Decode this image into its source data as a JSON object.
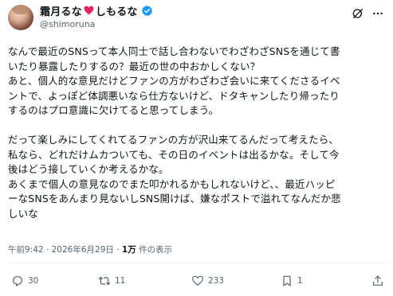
{
  "post": {
    "display_name": "霜月るな",
    "display_name_suffix": "しもるな",
    "handle": "@shimoruna",
    "body": "なんで最近のSNSって本人同士で話し合わないでわざわざSNSを通じて書\nいたり暴露したりするの？最近の世の中おかしくない？\nあと、個人的な意見だけどファンの方がわざわざ会いに来てくださるイベ\nントで、よっぽど体調悪いなら仕方ないけど、ドタキャンしたり帰ったり\nするのはプロ意識に欠けてると思ってしまう。\n\nだって楽しみにしてくれてるファンの方が沢山来てるんだって考えたら、\n私なら、どれだけムカついても、その日のイベントは出るかな。そして今\n後はどう接していくか考えるかな。\nあくまで個人の意見なのでまた叩かれるかもしれないけど、、最近ハッピ\nーなSNSをあんまり見ないしSNS開けば、嫌なポストで溢れてなんだか悲\nしいな",
    "time": "午前9:42",
    "separator": "·",
    "date": "2026年6月29日",
    "views_count": "1万",
    "views_label": " 件の表示"
  },
  "actions": {
    "reply_count": "30",
    "retweet_count": "11",
    "like_count": "233",
    "bookmark_count": "1"
  },
  "colors": {
    "text": "#0f1419",
    "secondary": "#536471",
    "verified": "#1d9bf0",
    "heart": "#e0245e",
    "divider": "#eff3f4"
  },
  "icons": [
    "verified-icon",
    "heart-emoji-icon",
    "grok-icon",
    "more-icon",
    "reply-icon",
    "retweet-icon",
    "like-icon",
    "views-icon",
    "bookmark-icon",
    "share-icon"
  ]
}
